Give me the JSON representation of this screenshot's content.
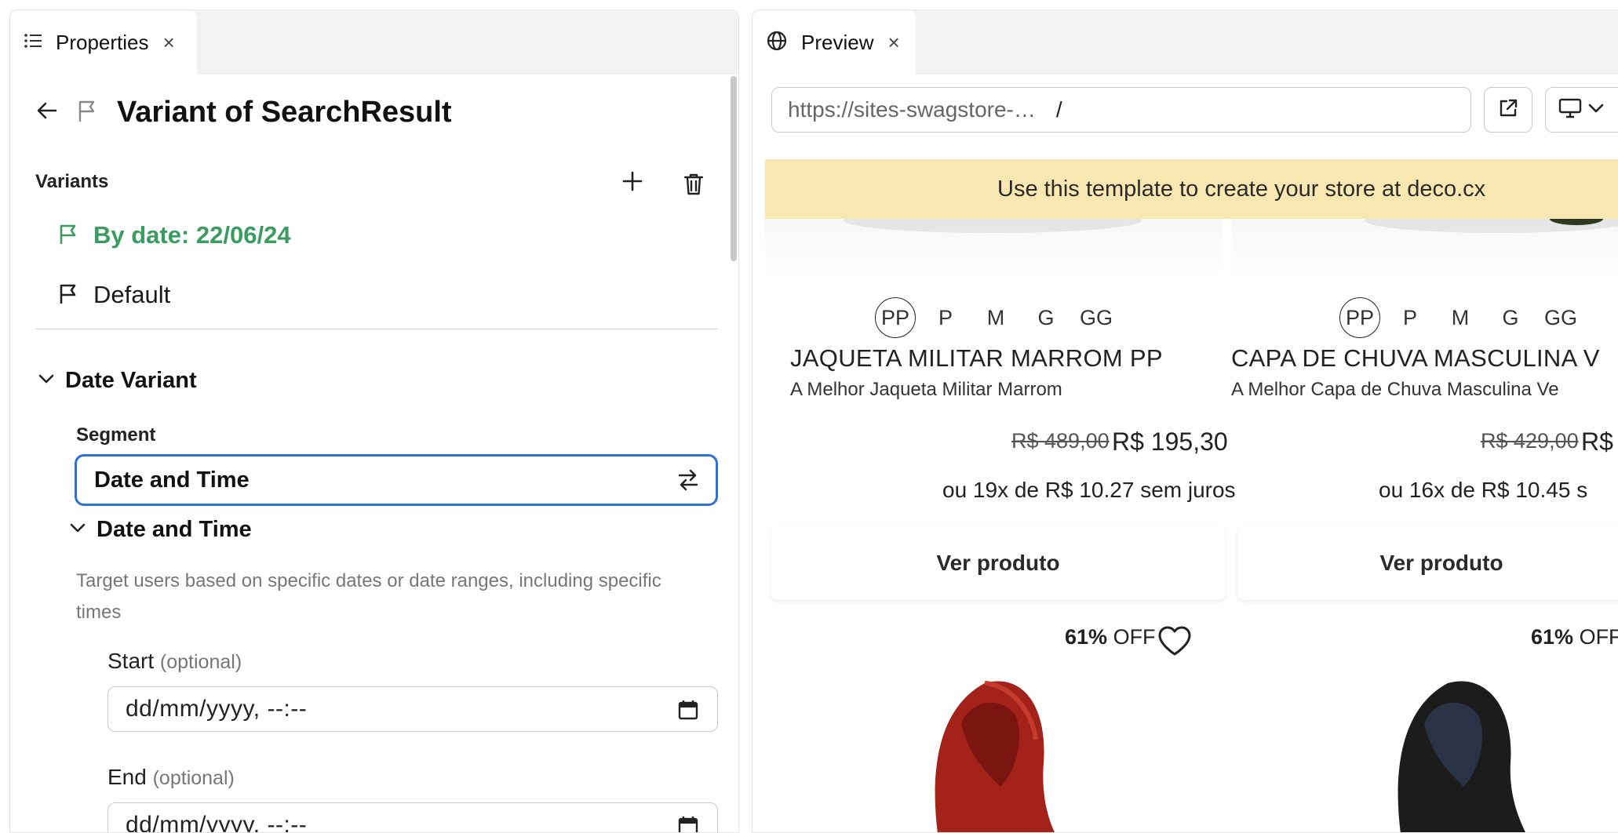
{
  "properties_panel": {
    "tab": {
      "label": "Properties",
      "icon": "list-icon",
      "close": "×"
    },
    "title": "Variant of SearchResult",
    "variants": {
      "label": "Variants",
      "items": [
        {
          "label": "By date: 22/06/24",
          "active": true
        },
        {
          "label": "Default",
          "active": false
        }
      ]
    },
    "date_variant": {
      "title": "Date Variant",
      "segment_label": "Segment",
      "segment_value": "Date and Time",
      "subsection_title": "Date and Time",
      "description": "Target users based on specific dates or date ranges, including specific times",
      "start": {
        "label": "Start",
        "optional": "(optional)",
        "value": "dd/mm/yyyy, --:--"
      },
      "end": {
        "label": "End",
        "optional": "(optional)",
        "value": "dd/mm/yyyy, --:--"
      }
    }
  },
  "preview_panel": {
    "tab": {
      "label": "Preview",
      "icon": "globe-icon",
      "close": "×"
    },
    "url": "https://sites-swagstore-…",
    "path": "/",
    "banner": "Use this template to create your store at deco.cx",
    "products": [
      {
        "sizes": [
          "PP",
          "P",
          "M",
          "G",
          "GG"
        ],
        "selected_size": "PP",
        "name": "JAQUETA MILITAR MARROM PP",
        "description": "A Melhor Jaqueta Militar Marrom",
        "old_price": "R$ 489,00",
        "new_price": "R$ 195,30",
        "installments": "ou 19x de R$ 10.27 sem juros",
        "button": "Ver produto"
      },
      {
        "sizes": [
          "PP",
          "P",
          "M",
          "G",
          "GG"
        ],
        "selected_size": "PP",
        "name": "CAPA DE CHUVA MASCULINA V",
        "description": "A Melhor Capa de Chuva Masculina Ve",
        "old_price": "R$ 429,00",
        "new_price": "R$",
        "installments": "ou 16x de R$ 10.45 s",
        "button": "Ver produto"
      }
    ],
    "discounts": [
      {
        "percent": "61%",
        "off": "OFF"
      },
      {
        "percent": "61%",
        "off": "OFF"
      }
    ]
  },
  "colors": {
    "accent_blue": "#2f6fd8",
    "active_variant_green": "#3a9c5f",
    "banner_yellow": "#f9e7b1",
    "hood_red": "#a3231b",
    "hood_black": "#1c1c1c"
  }
}
